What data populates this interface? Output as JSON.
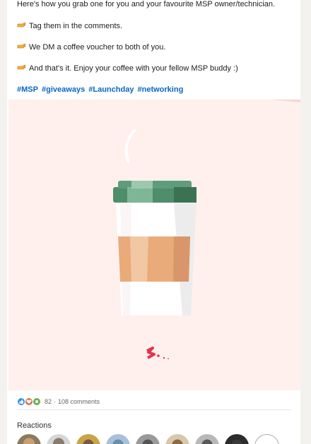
{
  "post": {
    "intro": "Here's how you grab one for you and your favourite MSP owner/technician.",
    "steps": [
      "Tag them in the comments.",
      "We DM a coffee voucher to both of you.",
      "And that's it. Enjoy your coffee with your fellow MSP buddy :)"
    ],
    "step_icon": "pointing-hand-icon",
    "hashtags": [
      "#MSP",
      "#giveaways",
      "#Launchday",
      "#networking"
    ]
  },
  "social": {
    "reaction_icons": [
      "like-icon",
      "love-icon",
      "support-icon"
    ],
    "reaction_count": "82",
    "separator": "·",
    "comments": "108 comments"
  },
  "reactions": {
    "title": "Reactions"
  },
  "colors": {
    "link": "#0a66c2",
    "media_bg": "#fff0ee",
    "cup_lid": "#4f8e6b",
    "cup_sleeve": "#e9ab79",
    "logo": "#e0364c"
  }
}
